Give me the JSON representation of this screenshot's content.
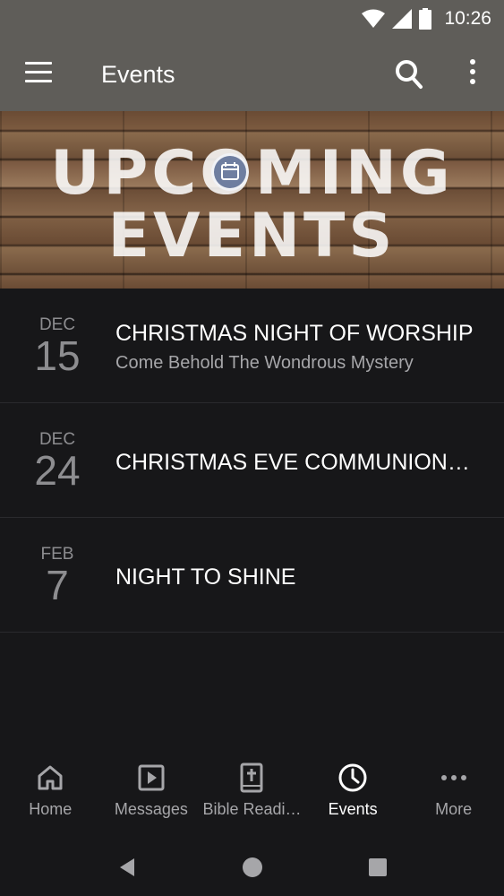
{
  "status": {
    "time": "10:26"
  },
  "app_bar": {
    "title": "Events"
  },
  "hero": {
    "line1": "UPCOMING",
    "line2": "EVENTS"
  },
  "events": [
    {
      "month": "DEC",
      "day": "15",
      "title": "CHRISTMAS NIGHT OF WORSHIP",
      "subtitle": "Come Behold The Wondrous Mystery"
    },
    {
      "month": "DEC",
      "day": "24",
      "title": "CHRISTMAS EVE COMMUNION…",
      "subtitle": ""
    },
    {
      "month": "FEB",
      "day": "7",
      "title": "NIGHT TO SHINE",
      "subtitle": ""
    }
  ],
  "bottom_nav": [
    {
      "label": "Home",
      "icon": "home-icon",
      "active": false
    },
    {
      "label": "Messages",
      "icon": "play-icon",
      "active": false
    },
    {
      "label": "Bible Readi…",
      "icon": "bible-icon",
      "active": false
    },
    {
      "label": "Events",
      "icon": "clock-icon",
      "active": true
    },
    {
      "label": "More",
      "icon": "more-dots-icon",
      "active": false
    }
  ],
  "colors": {
    "app_bar": "#5f5d59",
    "background": "#171719",
    "muted_text": "#8d8d90",
    "active_nav": "#ffffff"
  }
}
